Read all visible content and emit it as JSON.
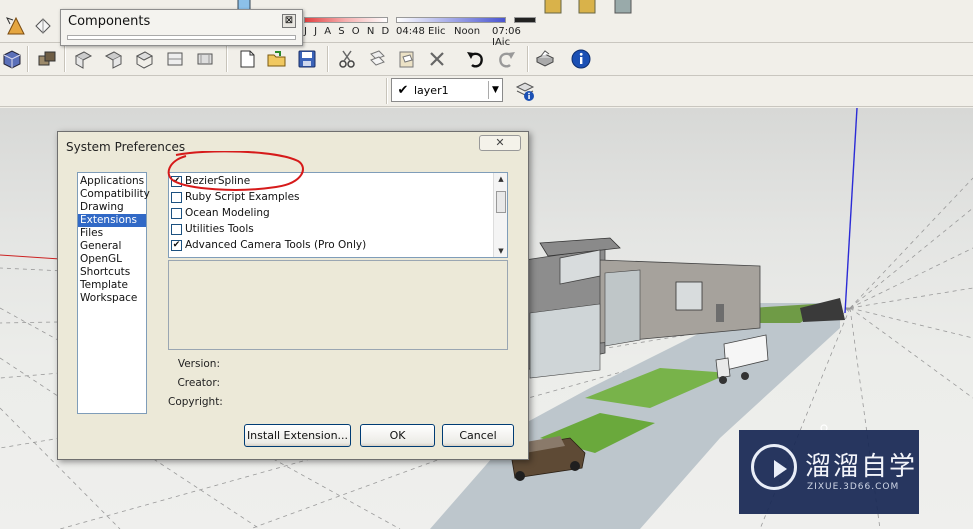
{
  "components_window": {
    "title": "Components",
    "close_label": "⊠"
  },
  "shadow": {
    "months": "J J A S O N D",
    "time_start": "04:48 EIic",
    "time_noon": "Noon",
    "time_end": "07:06 IAic"
  },
  "layer": {
    "check": "✔",
    "name": "layer1"
  },
  "dialog": {
    "title": "System Preferences",
    "close_label": "✕",
    "categories": [
      "Applications",
      "Compatibility",
      "Drawing",
      "Extensions",
      "Files",
      "General",
      "OpenGL",
      "Shortcuts",
      "Template",
      "Workspace"
    ],
    "selected_category": "Extensions",
    "extensions": [
      {
        "label": "BezierSpline",
        "checked": true
      },
      {
        "label": "Ruby Script Examples",
        "checked": false
      },
      {
        "label": "Ocean Modeling",
        "checked": false
      },
      {
        "label": "Utilities Tools",
        "checked": false
      },
      {
        "label": "Advanced Camera Tools (Pro Only)",
        "checked": true
      }
    ],
    "version_label": "Version:",
    "creator_label": "Creator:",
    "copyright_label": "Copyright:",
    "install_button": "Install Extension...",
    "ok_button": "OK",
    "cancel_button": "Cancel"
  },
  "watermark": {
    "name": "溜溜自学",
    "url": "ZIXUE.3D66.COM"
  },
  "colors": {
    "selection": "#3169c6",
    "annotation": "#d61a1a",
    "axis_blue": "#2b2bd6"
  }
}
